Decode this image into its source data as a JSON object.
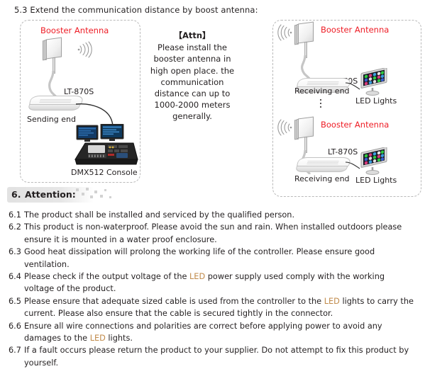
{
  "section_53": {
    "heading": "5.3 Extend the communication distance by boost antenna:"
  },
  "colors": {
    "red_label": "#ee1c25",
    "body_text": "#231f20",
    "highlight": "#c08a4a",
    "panel_border": "#b9b9b9",
    "band": "#e2e2e2"
  },
  "diagram": {
    "left_panel": {
      "antenna_label": "Booster Antenna",
      "controller_label": "LT-870S",
      "end_label": "Sending end",
      "console_label": "DMX512 Console",
      "icons": {
        "antenna": "panel-antenna-icon",
        "waves": "wireless-signal-icon",
        "console": "dmx-console-icon"
      }
    },
    "center_note": {
      "title": "【Attn】",
      "body": "Please install the booster antenna in high open place. the communication distance can up to 1000-2000 meters generally."
    },
    "right_panel": {
      "units": [
        {
          "antenna_label": "Booster Antenna",
          "controller_label": "LT-870S",
          "end_label": "Receiving end",
          "light_label": "LED Lights"
        },
        {
          "antenna_label": "Booster Antenna",
          "controller_label": "LT-870S",
          "end_label": "Receiving end",
          "light_label": "LED Lights"
        }
      ],
      "continuation": "vertical-ellipsis-icon"
    }
  },
  "section_6": {
    "number": "6.",
    "title": "Attention:",
    "items": [
      {
        "num": "6.1",
        "text": "The product shall be installed and serviced by the qualified person."
      },
      {
        "num": "6.2",
        "text": "This product is non-waterproof. Please avoid the sun and rain. When installed outdoors please ensure it is mounted in a water proof enclosure."
      },
      {
        "num": "6.3",
        "text": "Good heat dissipation will prolong the working life of the controller. Please ensure good ventilation."
      },
      {
        "num": "6.4",
        "text": "Please check if the output voltage of the LED power supply used comply with the working voltage of the product."
      },
      {
        "num": "6.5",
        "text": "Please ensure that adequate sized cable is used from the controller to the LED lights to carry the current. Please also ensure that the cable is secured tightly in the connector."
      },
      {
        "num": "6.6",
        "text": "Ensure all wire connections and polarities are correct before applying power to avoid any damages to the LED lights."
      },
      {
        "num": "6.7",
        "text": "If a fault occurs please return the product to your supplier. Do not attempt to fix this product by yourself."
      }
    ]
  }
}
